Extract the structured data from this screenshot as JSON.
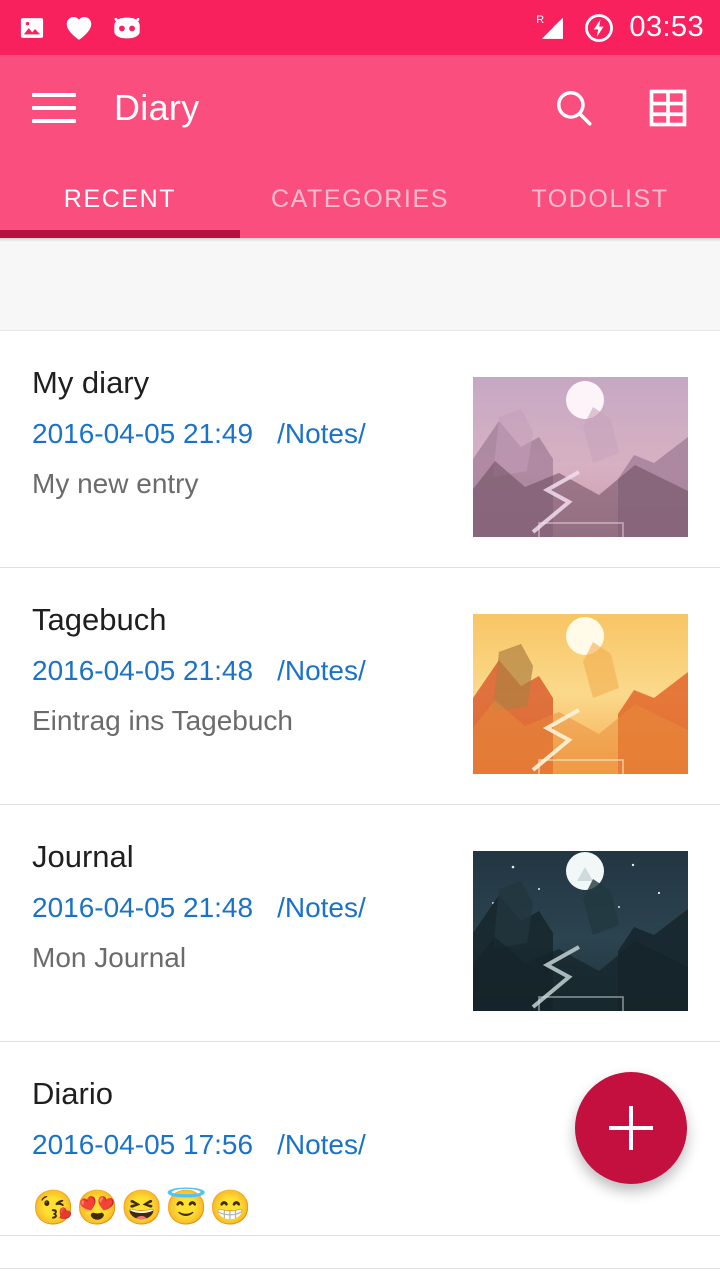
{
  "status_bar": {
    "icons": [
      "image-icon",
      "heart-icon",
      "cyanogenmod-icon"
    ],
    "signal_label": "R",
    "battery_icon": "battery-charging-icon",
    "time": "03:53",
    "background": "#f9205e"
  },
  "toolbar": {
    "menu_icon": "hamburger-menu-icon",
    "title": "Diary",
    "search_icon": "search-icon",
    "grid_icon": "grid-view-icon",
    "background": "#fa4e7e"
  },
  "tabs": {
    "indicator_color": "#b5103f",
    "active_index": 0,
    "items": [
      {
        "label": "RECENT"
      },
      {
        "label": "CATEGORIES"
      },
      {
        "label": "TODOLIST"
      }
    ]
  },
  "list": {
    "entries": [
      {
        "title": "My diary",
        "datetime": "2016-04-05 21:49",
        "folder": "/Notes/",
        "preview": "My new entry",
        "emoji": "",
        "thumbnail": "mountain-landscape-purple"
      },
      {
        "title": "Tagebuch",
        "datetime": "2016-04-05 21:48",
        "folder": "/Notes/",
        "preview": "Eintrag ins Tagebuch",
        "emoji": "",
        "thumbnail": "mountain-landscape-orange"
      },
      {
        "title": "Journal",
        "datetime": "2016-04-05 21:48",
        "folder": "/Notes/",
        "preview": "Mon Journal",
        "emoji": "",
        "thumbnail": "mountain-landscape-night"
      },
      {
        "title": "Diario",
        "datetime": "2016-04-05 17:56",
        "folder": "/Notes/",
        "preview": "",
        "emoji": "😘😍😆😇😁",
        "thumbnail": ""
      }
    ]
  },
  "fab": {
    "icon": "plus-icon",
    "color": "#c4103f"
  }
}
